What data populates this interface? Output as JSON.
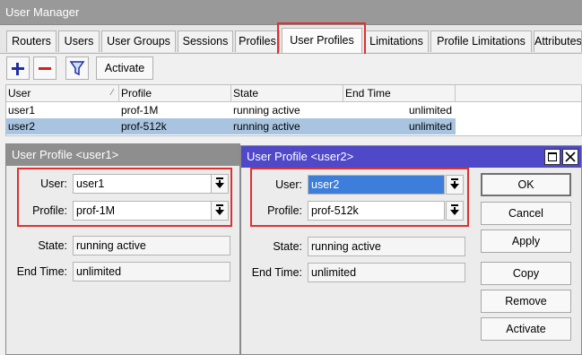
{
  "window": {
    "title": "User Manager"
  },
  "tabs": [
    {
      "label": "Routers"
    },
    {
      "label": "Users"
    },
    {
      "label": "User Groups"
    },
    {
      "label": "Sessions"
    },
    {
      "label": "Profiles"
    },
    {
      "label": "User Profiles",
      "active": true
    },
    {
      "label": "Limitations"
    },
    {
      "label": "Profile Limitations"
    },
    {
      "label": "Attributes"
    }
  ],
  "toolbar": {
    "add_icon": "plus-icon",
    "remove_icon": "minus-icon",
    "filter_icon": "filter-icon",
    "activate_label": "Activate"
  },
  "table": {
    "columns": [
      "User",
      "Profile",
      "State",
      "End Time"
    ],
    "rows": [
      {
        "user": "user1",
        "profile": "prof-1M",
        "state": "running active",
        "end_time": "unlimited"
      },
      {
        "user": "user2",
        "profile": "prof-512k",
        "state": "running active",
        "end_time": "unlimited",
        "selected": true
      }
    ]
  },
  "dialog1": {
    "title": "User Profile <user1>",
    "user_label": "User:",
    "user_value": "user1",
    "profile_label": "Profile:",
    "profile_value": "prof-1M",
    "state_label": "State:",
    "state_value": "running active",
    "end_time_label": "End Time:",
    "end_time_value": "unlimited"
  },
  "dialog2": {
    "title": "User Profile <user2>",
    "user_label": "User:",
    "user_value": "user2",
    "profile_label": "Profile:",
    "profile_value": "prof-512k",
    "state_label": "State:",
    "state_value": "running active",
    "end_time_label": "End Time:",
    "end_time_value": "unlimited",
    "buttons": {
      "ok": "OK",
      "cancel": "Cancel",
      "apply": "Apply",
      "copy": "Copy",
      "remove": "Remove",
      "activate": "Activate"
    }
  },
  "colors": {
    "active_title": "#4f48c8",
    "inactive_title": "#8e8e8e",
    "highlight_box": "#e03030",
    "selected_row": "#a8c4e0"
  }
}
